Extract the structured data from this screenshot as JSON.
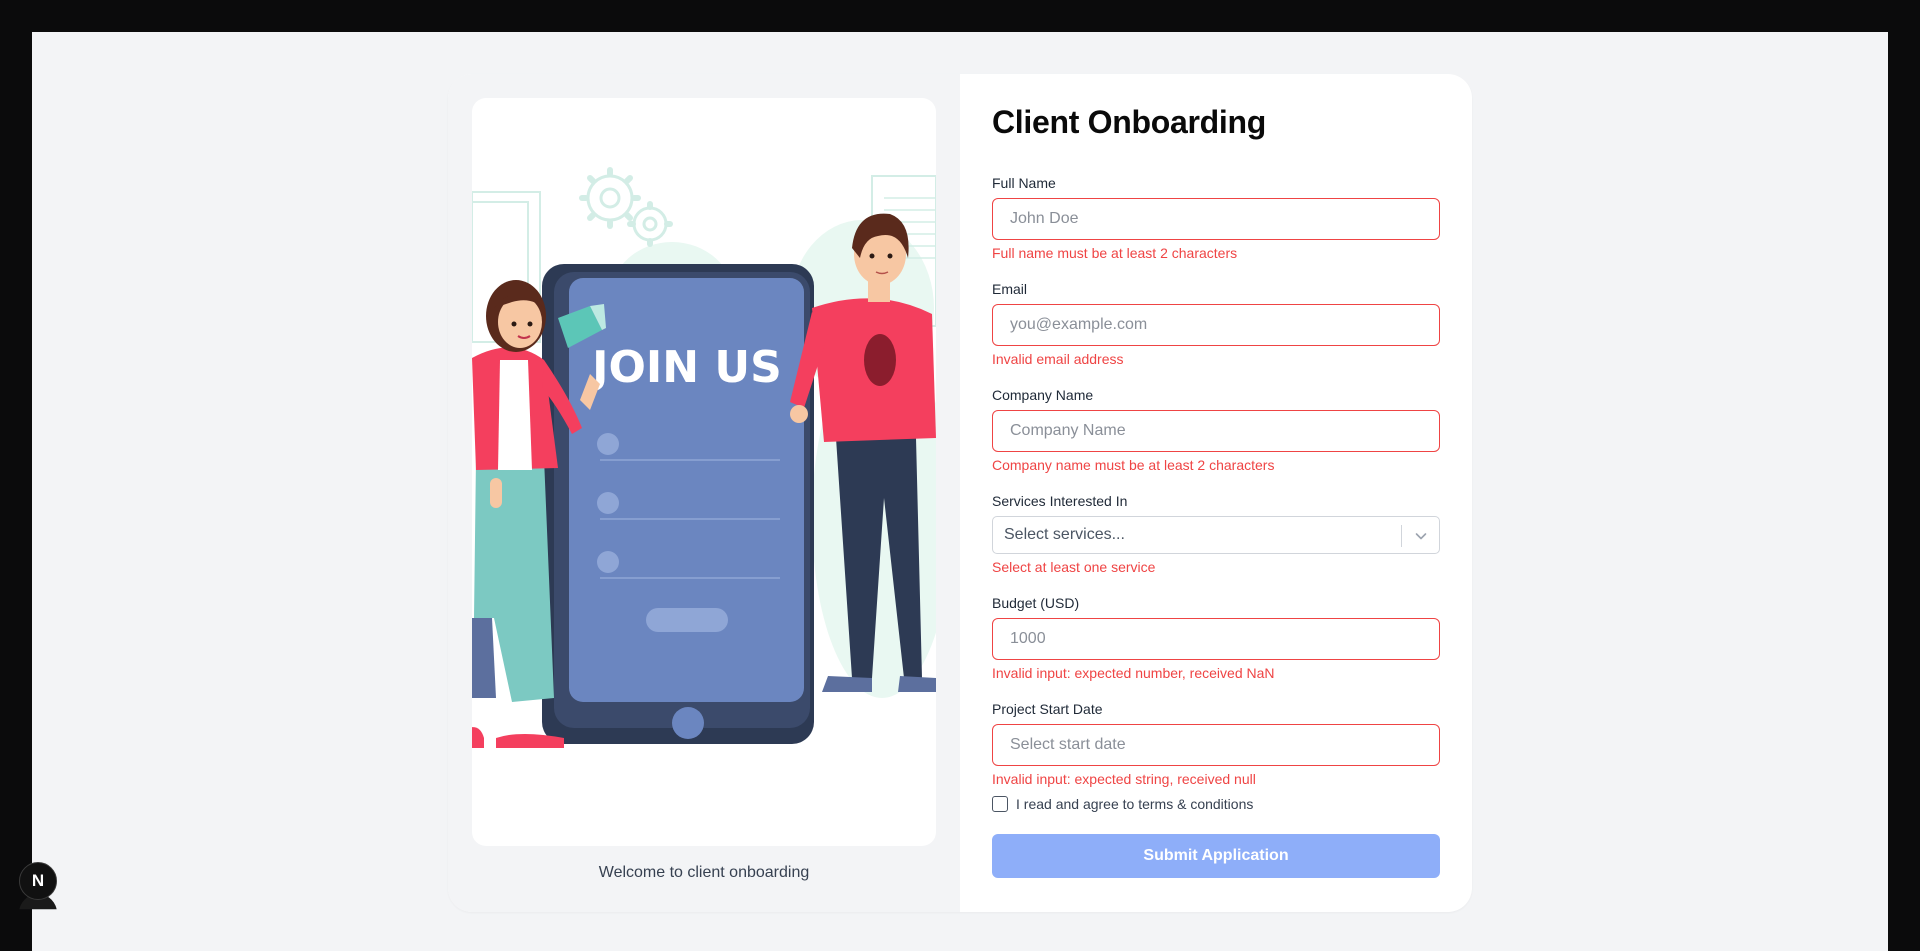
{
  "left": {
    "illustration_text": "JOIN US",
    "welcome": "Welcome to client onboarding"
  },
  "form": {
    "title": "Client Onboarding",
    "full_name": {
      "label": "Full Name",
      "placeholder": "John Doe",
      "value": "",
      "error": "Full name must be at least 2 characters"
    },
    "email": {
      "label": "Email",
      "placeholder": "you@example.com",
      "value": "",
      "error": "Invalid email address"
    },
    "company": {
      "label": "Company Name",
      "placeholder": "Company Name",
      "value": "",
      "error": "Company name must be at least 2 characters"
    },
    "services": {
      "label": "Services Interested In",
      "placeholder": "Select services...",
      "error": "Select at least one service"
    },
    "budget": {
      "label": "Budget (USD)",
      "placeholder": "1000",
      "value": "",
      "error": "Invalid input: expected number, received NaN"
    },
    "start_date": {
      "label": "Project Start Date",
      "placeholder": "Select start date",
      "value": "",
      "error": "Invalid input: expected string, received null"
    },
    "terms_label": "I read and agree to terms & conditions",
    "terms_checked": false,
    "submit_label": "Submit Application"
  },
  "dev_badge": {
    "letter": "N",
    "icon": "nextjs-icon"
  },
  "colors": {
    "error": "#ef4444",
    "submit_bg": "#8eaef9",
    "accent_red": "#f43f5e",
    "phone_screen": "#6b86c0"
  }
}
